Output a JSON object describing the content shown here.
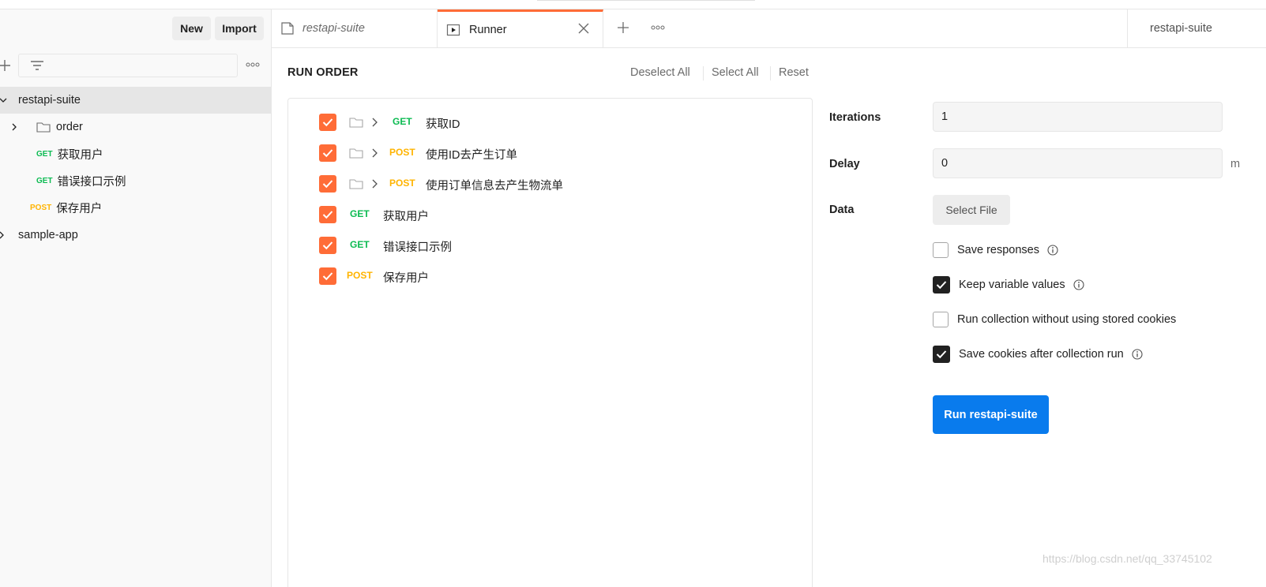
{
  "colors": {
    "accent": "#ff6c37",
    "primary": "#097bed",
    "get": "#0cbb52",
    "post": "#ffb400"
  },
  "sidebar": {
    "new_label": "New",
    "import_label": "Import",
    "tree": {
      "collection_1": "restapi-suite",
      "folder_order": "order",
      "req_1_method": "GET",
      "req_1_name": "获取用户",
      "req_2_method": "GET",
      "req_2_name": "错误接口示例",
      "req_3_method": "POST",
      "req_3_name": "保存用户",
      "collection_2": "sample-app"
    }
  },
  "tabs": {
    "tab_1": "restapi-suite",
    "tab_2": "Runner",
    "right_env": "restapi-suite"
  },
  "run_order": {
    "title": "RUN ORDER",
    "deselect_all": "Deselect All",
    "select_all": "Select All",
    "reset": "Reset",
    "rows": [
      {
        "method": "GET",
        "name": "获取ID",
        "folder": true,
        "checked": true
      },
      {
        "method": "POST",
        "name": "使用ID去产生订单",
        "folder": true,
        "checked": true
      },
      {
        "method": "POST",
        "name": "使用订单信息去产生物流单",
        "folder": true,
        "checked": true
      },
      {
        "method": "GET",
        "name": "获取用户",
        "folder": false,
        "checked": true
      },
      {
        "method": "GET",
        "name": "错误接口示例",
        "folder": false,
        "checked": true
      },
      {
        "method": "POST",
        "name": "保存用户",
        "folder": false,
        "checked": true
      }
    ]
  },
  "settings": {
    "iterations_label": "Iterations",
    "iterations_value": "1",
    "delay_label": "Delay",
    "delay_value": "0",
    "delay_unit": "m",
    "data_label": "Data",
    "select_file": "Select File",
    "save_responses": "Save responses",
    "keep_variable_values": "Keep variable values",
    "run_without_cookies": "Run collection without using stored cookies",
    "save_cookies": "Save cookies after collection run",
    "run_button": "Run restapi-suite"
  },
  "watermark": "https://blog.csdn.net/qq_33745102"
}
